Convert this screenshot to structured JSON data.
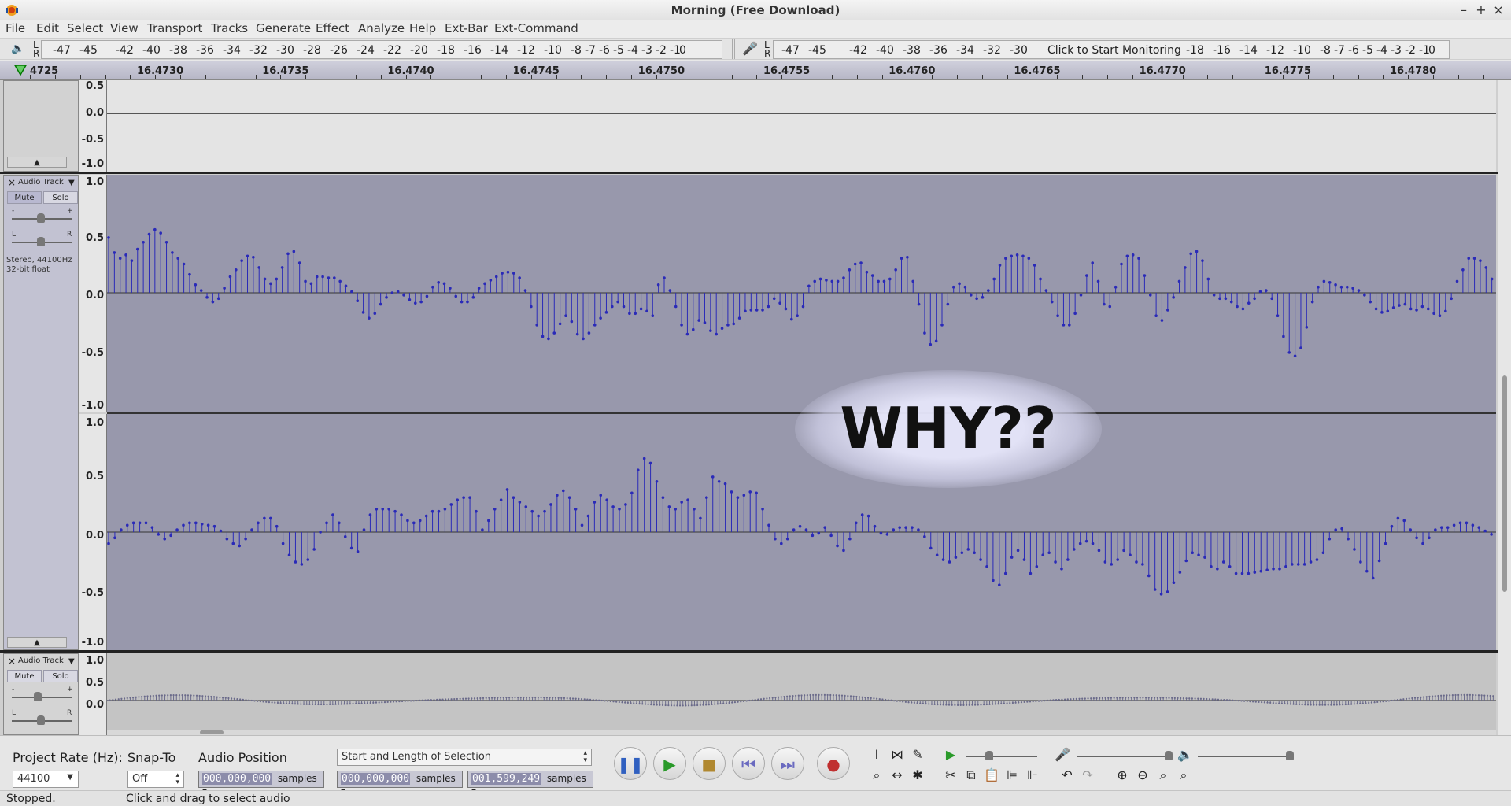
{
  "window": {
    "title": "Morning (Free Download)",
    "minimize": "–",
    "maximize": "+",
    "close": "×"
  },
  "menu": [
    "File",
    "Edit",
    "Select",
    "View",
    "Transport",
    "Tracks",
    "Generate",
    "Effect",
    "Analyze",
    "Help",
    "Ext-Bar",
    "Ext-Command"
  ],
  "playback_meter": {
    "ticks": [
      "-47",
      "-45",
      "-42",
      "-40",
      "-38",
      "-36",
      "-34",
      "-32",
      "-30",
      "-28",
      "-26",
      "-24",
      "-22",
      "-20",
      "-18",
      "-16",
      "-14",
      "-12",
      "-10",
      "-8",
      "-7",
      "-6",
      "-5",
      "-4",
      "-3",
      "-2",
      "-1",
      "0"
    ]
  },
  "record_meter": {
    "ticks_left": [
      "-47",
      "-45",
      "-42",
      "-40",
      "-38",
      "-36",
      "-34",
      "-32",
      "-30"
    ],
    "message": "Click to Start Monitoring",
    "ticks_right": [
      "-18",
      "-16",
      "-14",
      "-12",
      "-10",
      "-8",
      "-7",
      "-6",
      "-5",
      "-4",
      "-3",
      "-2",
      "-1",
      "0"
    ]
  },
  "meter_channels": {
    "left": "L",
    "right": "R"
  },
  "ruler": {
    "ticks": [
      "4725",
      "16.4730",
      "16.4735",
      "16.4740",
      "16.4745",
      "16.4750",
      "16.4755",
      "16.4760",
      "16.4765",
      "16.4770",
      "16.4775",
      "16.4780"
    ]
  },
  "tracks": {
    "top_scale": [
      "0.5",
      "0.0",
      "-0.5",
      "-1.0"
    ],
    "stereo_track": {
      "name": "Audio Track",
      "mute": "Mute",
      "solo": "Solo",
      "gain_minus": "-",
      "gain_plus": "+",
      "pan_left": "L",
      "pan_right": "R",
      "info_line1": "Stereo, 44100Hz",
      "info_line2": "32-bit float",
      "scale": [
        "1.0",
        "0.5",
        "0.0",
        "-0.5",
        "-1.0"
      ],
      "left_samples": [
        0.48,
        0.35,
        0.3,
        0.33,
        0.28,
        0.38,
        0.44,
        0.51,
        0.55,
        0.52,
        0.44,
        0.35,
        0.3,
        0.25,
        0.16,
        0.07,
        0.02,
        -0.04,
        -0.08,
        -0.05,
        0.04,
        0.14,
        0.2,
        0.28,
        0.32,
        0.31,
        0.22,
        0.12,
        0.08,
        0.12,
        0.22,
        0.34,
        0.36,
        0.26,
        0.1,
        0.08,
        0.14,
        0.14,
        0.13,
        0.13,
        0.1,
        0.06,
        0.01,
        -0.07,
        -0.17,
        -0.22,
        -0.18,
        -0.1,
        -0.04,
        0,
        0.01,
        -0.02,
        -0.06,
        -0.09,
        -0.08,
        -0.03,
        0.05,
        0.09,
        0.08,
        0.04,
        -0.03,
        -0.08,
        -0.08,
        -0.04,
        0.04,
        0.08,
        0.11,
        0.14,
        0.17,
        0.18,
        0.17,
        0.13,
        0.02,
        -0.12,
        -0.28,
        -0.38,
        -0.4,
        -0.35,
        -0.27,
        -0.2,
        -0.25,
        -0.36,
        -0.4,
        -0.35,
        -0.28,
        -0.22,
        -0.17,
        -0.12,
        -0.08,
        -0.12,
        -0.18,
        -0.18,
        -0.14,
        -0.16,
        -0.2,
        0.07,
        0.13,
        0.02,
        -0.12,
        -0.28,
        -0.36,
        -0.32,
        -0.24,
        -0.26,
        -0.33,
        -0.36,
        -0.31,
        -0.28,
        -0.27,
        -0.22,
        -0.16,
        -0.15,
        -0.15,
        -0.15,
        -0.12,
        -0.05,
        -0.09,
        -0.14,
        -0.23,
        -0.2,
        -0.12,
        0.06,
        0.1,
        0.12,
        0.11,
        0.1,
        0.1,
        0.13,
        0.2,
        0.25,
        0.26,
        0.18,
        0.15,
        0.1,
        0.1,
        0.12,
        0.2,
        0.3,
        0.31,
        0.1,
        -0.1,
        -0.35,
        -0.45,
        -0.42,
        -0.28,
        -0.1,
        0.05,
        0.08,
        0.05,
        -0.02,
        -0.05,
        -0.04,
        0.02,
        0.12,
        0.24,
        0.3,
        0.32,
        0.33,
        0.32,
        0.3,
        0.24,
        0.12,
        0.02,
        -0.08,
        -0.2,
        -0.28,
        -0.28,
        -0.18,
        -0.02,
        0.15,
        0.26,
        0.1,
        -0.1,
        -0.12,
        0.05,
        0.25,
        0.32,
        0.33,
        0.3,
        0.15,
        -0.02,
        -0.2,
        -0.24,
        -0.15,
        -0.04,
        0.1,
        0.22,
        0.34,
        0.36,
        0.28,
        0.12,
        -0.02,
        -0.05,
        -0.05,
        -0.08,
        -0.12,
        -0.14,
        -0.09,
        -0.05,
        0.01,
        0.02,
        -0.05,
        -0.2,
        -0.38,
        -0.52,
        -0.55,
        -0.48,
        -0.3,
        -0.08,
        0.05,
        0.1,
        0.09,
        0.07,
        0.05,
        0.05,
        0.04,
        0.02,
        -0.02,
        -0.08,
        -0.14,
        -0.17,
        -0.16,
        -0.13,
        -0.11,
        -0.1,
        -0.14,
        -0.15,
        -0.12,
        -0.14,
        -0.18,
        -0.2,
        -0.16,
        -0.05,
        0.1,
        0.2,
        0.3,
        0.3,
        0.28,
        0.22,
        0.12
      ],
      "right_samples": [
        -0.1,
        -0.05,
        0.02,
        0.06,
        0.08,
        0.08,
        0.08,
        0.04,
        -0.02,
        -0.06,
        -0.03,
        0.02,
        0.06,
        0.08,
        0.08,
        0.07,
        0.06,
        0.05,
        0.01,
        -0.06,
        -0.1,
        -0.12,
        -0.06,
        0.02,
        0.08,
        0.12,
        0.12,
        0.05,
        -0.1,
        -0.2,
        -0.26,
        -0.28,
        -0.24,
        -0.15,
        0,
        0.08,
        0.15,
        0.08,
        -0.04,
        -0.14,
        -0.17,
        0.02,
        0.15,
        0.2,
        0.2,
        0.2,
        0.18,
        0.15,
        0.1,
        0.08,
        0.1,
        0.14,
        0.18,
        0.18,
        0.2,
        0.24,
        0.28,
        0.3,
        0.3,
        0.18,
        0.02,
        0.1,
        0.2,
        0.28,
        0.37,
        0.3,
        0.26,
        0.22,
        0.18,
        0.14,
        0.18,
        0.24,
        0.32,
        0.36,
        0.3,
        0.2,
        0.06,
        0.14,
        0.26,
        0.32,
        0.28,
        0.22,
        0.2,
        0.24,
        0.34,
        0.54,
        0.64,
        0.6,
        0.44,
        0.3,
        0.22,
        0.2,
        0.26,
        0.28,
        0.2,
        0.12,
        0.3,
        0.48,
        0.44,
        0.42,
        0.35,
        0.3,
        0.32,
        0.35,
        0.34,
        0.2,
        0.06,
        -0.06,
        -0.1,
        -0.06,
        0.02,
        0.05,
        0.02,
        -0.03,
        -0.01,
        0.04,
        -0.03,
        -0.12,
        -0.16,
        -0.06,
        0.08,
        0.15,
        0.14,
        0.05,
        -0.01,
        -0.02,
        0.02,
        0.04,
        0.04,
        0.04,
        0.02,
        -0.04,
        -0.14,
        -0.2,
        -0.24,
        -0.26,
        -0.22,
        -0.18,
        -0.15,
        -0.18,
        -0.24,
        -0.3,
        -0.42,
        -0.46,
        -0.36,
        -0.22,
        -0.16,
        -0.24,
        -0.36,
        -0.3,
        -0.2,
        -0.18,
        -0.26,
        -0.32,
        -0.24,
        -0.15,
        -0.1,
        -0.08,
        -0.1,
        -0.16,
        -0.26,
        -0.28,
        -0.24,
        -0.16,
        -0.2,
        -0.26,
        -0.28,
        -0.38,
        -0.5,
        -0.54,
        -0.52,
        -0.44,
        -0.35,
        -0.25,
        -0.18,
        -0.2,
        -0.22,
        -0.3,
        -0.32,
        -0.26,
        -0.3,
        -0.36,
        -0.36,
        -0.36,
        -0.35,
        -0.34,
        -0.33,
        -0.32,
        -0.32,
        -0.3,
        -0.28,
        -0.28,
        -0.28,
        -0.26,
        -0.24,
        -0.18,
        -0.06,
        0.02,
        0.03,
        -0.06,
        -0.15,
        -0.26,
        -0.34,
        -0.4,
        -0.25,
        -0.1,
        0.05,
        0.12,
        0.1,
        0.02,
        -0.05,
        -0.1,
        -0.05,
        0.02,
        0.04,
        0.04,
        0.06,
        0.08,
        0.08,
        0.06,
        0.04,
        0.01,
        -0.02
      ]
    },
    "third_track": {
      "name": "Audio Track",
      "mute": "Mute",
      "solo": "Solo",
      "gain_minus": "-",
      "gain_plus": "+",
      "pan_left": "L",
      "pan_right": "R",
      "scale": [
        "1.0",
        "0.5",
        "0.0"
      ]
    }
  },
  "overlay_text": "WHY??",
  "selection_toolbar": {
    "project_rate_label": "Project Rate (Hz):",
    "project_rate_value": "44100",
    "snap_to_label": "Snap-To",
    "snap_to_value": "Off",
    "audio_position_label": "Audio Position",
    "audio_position_value": "000,000,000",
    "selection_mode": "Start and Length of Selection",
    "selection_start": "000,000,000",
    "selection_length": "001,599,249",
    "unit": "samples"
  },
  "status": {
    "state": "Stopped.",
    "hint": "Click and drag to select audio"
  }
}
